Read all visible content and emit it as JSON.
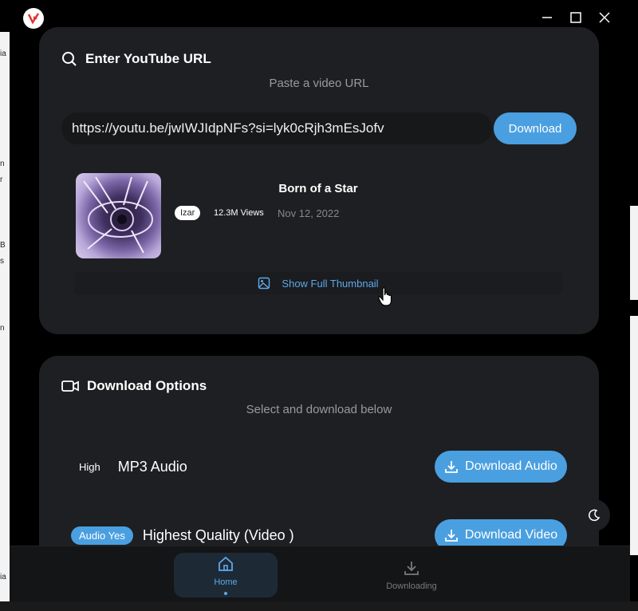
{
  "window": {
    "controls": {
      "minimize": "—",
      "maximize": "☐",
      "close": "✕"
    }
  },
  "url_card": {
    "title": "Enter YouTube URL",
    "subtitle": "Paste a video URL",
    "url_value": "https://youtu.be/jwIWJIdpNFs?si=lyk0cRjh3mEsJofv",
    "download_label": "Download"
  },
  "video": {
    "title": "Born of a Star",
    "channel": "Izar",
    "views": "12.3M Views",
    "date": "Nov 12, 2022",
    "show_thumb_label": "Show Full Thumbnail"
  },
  "options_card": {
    "title": "Download Options",
    "subtitle": "Select and download below",
    "rows": [
      {
        "quality": "High",
        "label": "MP3 Audio",
        "button": "Download Audio"
      },
      {
        "quality": "Audio Yes",
        "label": "Highest Quality (Video )",
        "button": "Download Video"
      }
    ]
  },
  "nav": {
    "home": "Home",
    "downloading": "Downloading"
  },
  "colors": {
    "accent": "#4a9fe0",
    "card_bg": "#1d1f22",
    "link": "#5fa8e8"
  },
  "icons": [
    "app-logo-icon",
    "minimize-icon",
    "maximize-icon",
    "close-icon",
    "search-icon",
    "image-icon",
    "video-camera-icon",
    "download-icon",
    "moon-icon",
    "home-icon",
    "downloading-icon"
  ]
}
